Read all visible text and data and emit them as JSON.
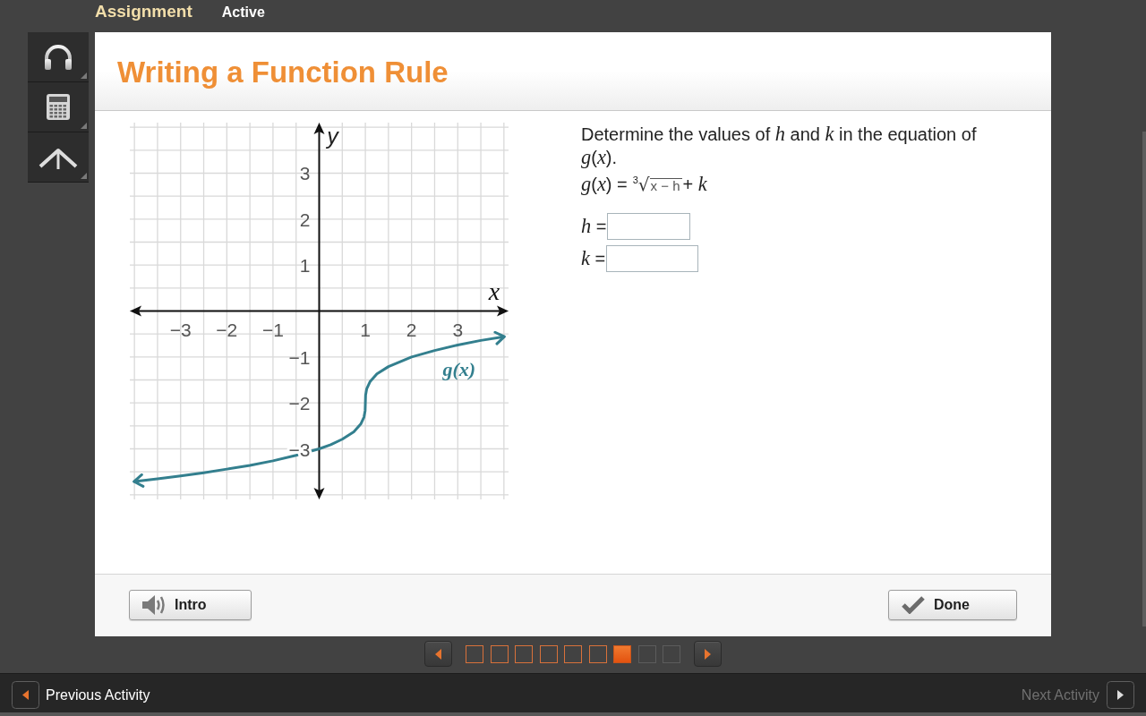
{
  "header": {
    "assignment_label": "Assignment",
    "status": "Active"
  },
  "lesson": {
    "title": "Writing a Function Rule"
  },
  "graph": {
    "chart_data": [
      {
        "type": "line",
        "xlabel": "x",
        "ylabel": "y",
        "xlim": [
          -4.1,
          4.1
        ],
        "ylim": [
          -4.1,
          4.1
        ],
        "xticks": [
          {
            "value": -3,
            "label": "−3"
          },
          {
            "value": -2,
            "label": "−2"
          },
          {
            "value": -1,
            "label": "−1"
          },
          1,
          2,
          3
        ],
        "yticks": [
          {
            "value": -3,
            "label": "−3"
          },
          {
            "value": -2,
            "label": "−2"
          },
          {
            "value": -1,
            "label": "−1"
          },
          1,
          2,
          3
        ],
        "grid": true,
        "series": [
          {
            "name": "g(x)",
            "color": "#337f8e",
            "x": [
              -4,
              -3.5,
              -3,
              -2.5,
              -2,
              -1.5,
              -1,
              -0.5,
              0,
              0.25,
              0.5,
              0.75,
              0.9,
              0.97,
              0.995,
              1,
              1.005,
              1.03,
              1.1,
              1.25,
              1.5,
              2,
              2.5,
              3,
              3.5,
              4
            ],
            "values": [
              -3.71,
              -3.65,
              -3.59,
              -3.52,
              -3.44,
              -3.36,
              -3.26,
              -3.14,
              -3,
              -2.91,
              -2.79,
              -2.63,
              -2.46,
              -2.31,
              -2.17,
              -2,
              -1.83,
              -1.69,
              -1.54,
              -1.37,
              -1.21,
              -1,
              -0.86,
              -0.74,
              -0.64,
              -0.56
            ]
          }
        ]
      }
    ]
  },
  "question": {
    "prompt": "Determine the values of *h* and *k* in the equation of *g*(*x*).",
    "equation": {
      "lhs": "*g*(*x*) =",
      "root_index": "3",
      "root_sign": "√",
      "radicand": "x − h",
      "tail": "+ *k*"
    },
    "answers": [
      {
        "label": "*h* ="
      },
      {
        "label": "*k* ="
      }
    ]
  },
  "footer": {
    "buttons": [
      {
        "kind": "intro",
        "label": "Intro"
      },
      {
        "kind": "done",
        "label": "Done"
      }
    ]
  },
  "pager": {
    "pages": [
      {
        "selected": false,
        "visited": true
      },
      {
        "selected": false,
        "visited": true
      },
      {
        "selected": false,
        "visited": true
      },
      {
        "selected": false,
        "visited": true
      },
      {
        "selected": false,
        "visited": true
      },
      {
        "selected": false,
        "visited": true
      },
      {
        "selected": true,
        "visited": true
      },
      {
        "selected": false,
        "visited": false
      },
      {
        "selected": false,
        "visited": false
      }
    ]
  },
  "activity_nav": [
    {
      "kind": "previous",
      "label": "Previous Activity",
      "disabled": false
    },
    {
      "kind": "next",
      "label": "Next Activity",
      "disabled": true
    }
  ]
}
